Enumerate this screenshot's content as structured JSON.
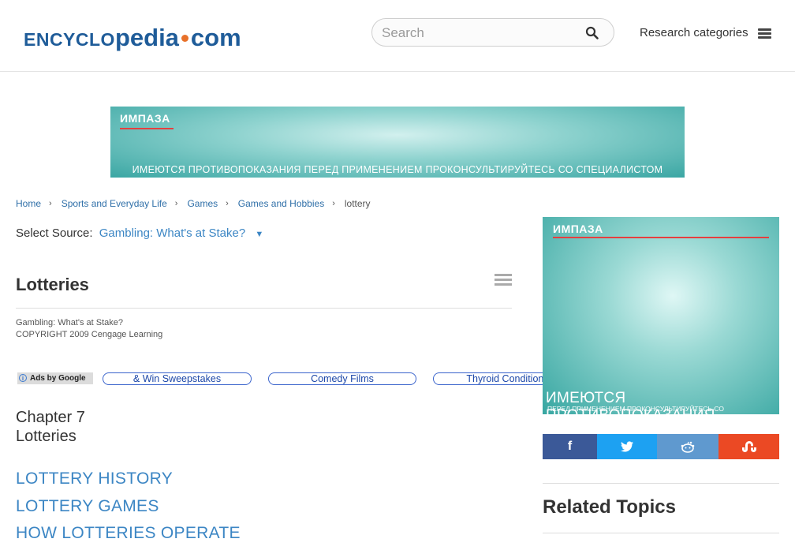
{
  "header": {
    "logo": {
      "part1": "ENCYCLO",
      "part2": "pedia",
      "part3": "com"
    },
    "search_placeholder": "Search",
    "research_label": "Research categories"
  },
  "banner_ad": {
    "brand": "ИМПАЗА",
    "warning": "ИМЕЮТСЯ ПРОТИВОПОКАЗАНИЯ ПЕРЕД ПРИМЕНЕНИЕМ ПРОКОНСУЛЬТИРУЙТЕСЬ СО СПЕЦИАЛИСТОМ"
  },
  "breadcrumb": [
    "Home",
    "Sports and Everyday Life",
    "Games",
    "Games and Hobbies",
    "lottery"
  ],
  "select_source": {
    "label": "Select Source:",
    "value": "Gambling: What's at Stake?",
    "arrow": "▼"
  },
  "article": {
    "title": "Lotteries",
    "source": "Gambling: What's at Stake?",
    "copyright": "COPYRIGHT 2009 Cengage Learning",
    "chapter": "Chapter 7",
    "chapter_title": "Lotteries",
    "sections": [
      "LOTTERY HISTORY",
      "LOTTERY GAMES",
      "HOW LOTTERIES OPERATE"
    ]
  },
  "ads": {
    "label": "Ads by Google",
    "links": [
      "& Win Sweepstakes",
      "Comedy Films",
      "Thyroid Conditions"
    ]
  },
  "side_ad": {
    "brand": "ИМПАЗА",
    "warning_big": "ИМЕЮТСЯ ПРОТИВОПОКАЗАНИЯ",
    "warning_small": "ПЕРЕД ПРИМЕНЕНИЕМ ПРОКОНСУЛЬТИРУЙТЕСЬ СО СПЕЦИАЛИСТОМ"
  },
  "share": [
    {
      "name": "facebook-icon",
      "glyph": "f",
      "color": "#3b5998"
    },
    {
      "name": "twitter-icon",
      "glyph": "🐦",
      "color": "#1da1f2"
    },
    {
      "name": "reddit-icon",
      "glyph": "👾",
      "color": "#5f99cf"
    },
    {
      "name": "stumbleupon-icon",
      "glyph": "ʃu",
      "color": "#eb4924"
    }
  ],
  "related_title": "Related Topics",
  "colors": {
    "brand_blue": "#1f5c99",
    "link_blue": "#3c86c4",
    "accent_orange": "#e8712a"
  }
}
